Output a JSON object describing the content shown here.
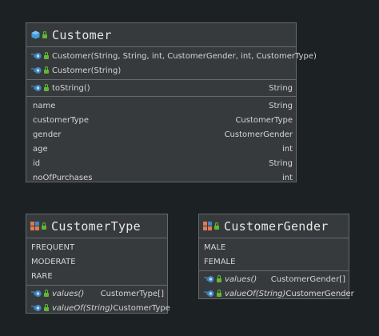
{
  "customer": {
    "title": "Customer",
    "constructors": [
      {
        "name": "Customer(String, String, int, CustomerGender, int, CustomerType)",
        "type": ""
      },
      {
        "name": "Customer(String)",
        "type": ""
      }
    ],
    "methods": [
      {
        "name": "toString()",
        "type": "String"
      }
    ],
    "fields": [
      {
        "name": "name",
        "type": "String"
      },
      {
        "name": "customerType",
        "type": "CustomerType"
      },
      {
        "name": "gender",
        "type": "CustomerGender"
      },
      {
        "name": "age",
        "type": "int"
      },
      {
        "name": "id",
        "type": "String"
      },
      {
        "name": "noOfPurchases",
        "type": "int"
      }
    ]
  },
  "customer_type": {
    "title": "CustomerType",
    "constants": [
      "FREQUENT",
      "MODERATE",
      "RARE"
    ],
    "methods": [
      {
        "name": "values()",
        "type": "CustomerType[]"
      },
      {
        "name": "valueOf(String)",
        "type": "CustomerType"
      }
    ]
  },
  "customer_gender": {
    "title": "CustomerGender",
    "constants": [
      "MALE",
      "FEMALE"
    ],
    "methods": [
      {
        "name": "values()",
        "type": "CustomerGender[]"
      },
      {
        "name": "valueOf(String)",
        "type": "CustomerGender"
      }
    ]
  },
  "icons": {
    "class": "class-icon",
    "enum": "enum-icon",
    "method": "method-icon",
    "lock": "public-lock-icon"
  },
  "colors": {
    "background": "#1c2124",
    "box": "#373a3d",
    "border": "#646a70",
    "lock": "#5fb832",
    "class_icon": "#3f9fd8",
    "enum_icon": "#e07b53"
  }
}
